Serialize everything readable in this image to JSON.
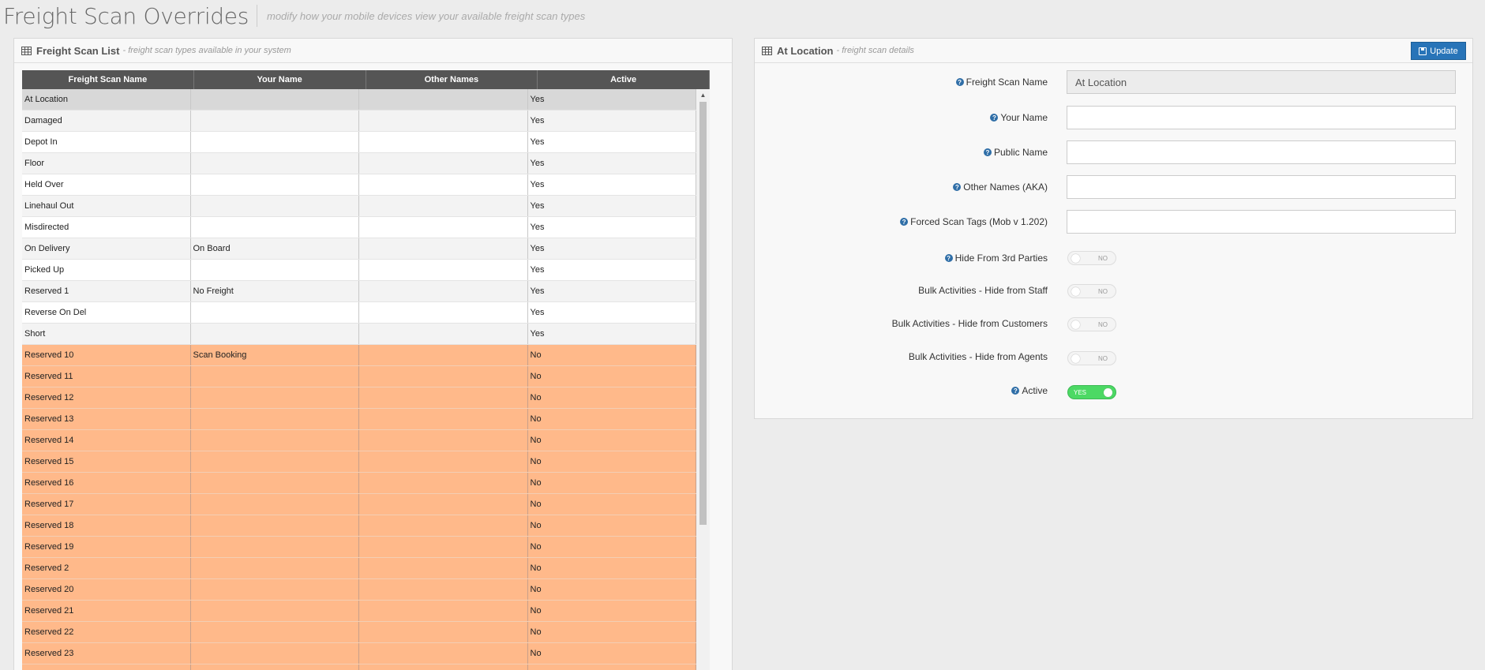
{
  "header": {
    "title": "Freight Scan Overrides",
    "subtitle": "modify how your mobile devices view your available freight scan types"
  },
  "list_panel": {
    "title": "Freight Scan List",
    "subtitle": "- freight scan types available in your system",
    "columns": [
      "Freight Scan Name",
      "Your Name",
      "Other Names",
      "Active"
    ],
    "rows": [
      {
        "name": "At Location",
        "your_name": "",
        "other_names": "",
        "active": "Yes",
        "state": "selected"
      },
      {
        "name": "Damaged",
        "your_name": "",
        "other_names": "",
        "active": "Yes",
        "state": "odd"
      },
      {
        "name": "Depot In",
        "your_name": "",
        "other_names": "",
        "active": "Yes",
        "state": "even"
      },
      {
        "name": "Floor",
        "your_name": "",
        "other_names": "",
        "active": "Yes",
        "state": "odd"
      },
      {
        "name": "Held Over",
        "your_name": "",
        "other_names": "",
        "active": "Yes",
        "state": "even"
      },
      {
        "name": "Linehaul Out",
        "your_name": "",
        "other_names": "",
        "active": "Yes",
        "state": "odd"
      },
      {
        "name": "Misdirected",
        "your_name": "",
        "other_names": "",
        "active": "Yes",
        "state": "even"
      },
      {
        "name": "On Delivery",
        "your_name": "On Board",
        "other_names": "",
        "active": "Yes",
        "state": "odd"
      },
      {
        "name": "Picked Up",
        "your_name": "",
        "other_names": "",
        "active": "Yes",
        "state": "even"
      },
      {
        "name": "Reserved 1",
        "your_name": "No Freight",
        "other_names": "",
        "active": "Yes",
        "state": "odd"
      },
      {
        "name": "Reverse On Del",
        "your_name": "",
        "other_names": "",
        "active": "Yes",
        "state": "even"
      },
      {
        "name": "Short",
        "your_name": "",
        "other_names": "",
        "active": "Yes",
        "state": "odd"
      },
      {
        "name": "Reserved 10",
        "your_name": "Scan Booking",
        "other_names": "",
        "active": "No",
        "state": "inactive"
      },
      {
        "name": "Reserved 11",
        "your_name": "",
        "other_names": "",
        "active": "No",
        "state": "inactive"
      },
      {
        "name": "Reserved 12",
        "your_name": "",
        "other_names": "",
        "active": "No",
        "state": "inactive"
      },
      {
        "name": "Reserved 13",
        "your_name": "",
        "other_names": "",
        "active": "No",
        "state": "inactive"
      },
      {
        "name": "Reserved 14",
        "your_name": "",
        "other_names": "",
        "active": "No",
        "state": "inactive"
      },
      {
        "name": "Reserved 15",
        "your_name": "",
        "other_names": "",
        "active": "No",
        "state": "inactive"
      },
      {
        "name": "Reserved 16",
        "your_name": "",
        "other_names": "",
        "active": "No",
        "state": "inactive"
      },
      {
        "name": "Reserved 17",
        "your_name": "",
        "other_names": "",
        "active": "No",
        "state": "inactive"
      },
      {
        "name": "Reserved 18",
        "your_name": "",
        "other_names": "",
        "active": "No",
        "state": "inactive"
      },
      {
        "name": "Reserved 19",
        "your_name": "",
        "other_names": "",
        "active": "No",
        "state": "inactive"
      },
      {
        "name": "Reserved 2",
        "your_name": "",
        "other_names": "",
        "active": "No",
        "state": "inactive"
      },
      {
        "name": "Reserved 20",
        "your_name": "",
        "other_names": "",
        "active": "No",
        "state": "inactive"
      },
      {
        "name": "Reserved 21",
        "your_name": "",
        "other_names": "",
        "active": "No",
        "state": "inactive"
      },
      {
        "name": "Reserved 22",
        "your_name": "",
        "other_names": "",
        "active": "No",
        "state": "inactive"
      },
      {
        "name": "Reserved 23",
        "your_name": "",
        "other_names": "",
        "active": "No",
        "state": "inactive"
      },
      {
        "name": "",
        "your_name": "",
        "other_names": "",
        "active": "",
        "state": "inactive"
      }
    ]
  },
  "detail_panel": {
    "title": "At Location",
    "subtitle": "- freight scan details",
    "update_label": "Update",
    "fields": {
      "freight_scan_name": {
        "label": "Freight Scan Name",
        "value": "At Location"
      },
      "your_name": {
        "label": "Your Name",
        "value": ""
      },
      "public_name": {
        "label": "Public Name",
        "value": ""
      },
      "other_names": {
        "label": "Other Names (AKA)",
        "value": ""
      },
      "forced_scan_tags": {
        "label": "Forced Scan Tags (Mob v 1.202)",
        "value": ""
      }
    },
    "toggles": {
      "hide_3rd": {
        "label": "Hide From 3rd Parties",
        "value": "NO"
      },
      "bulk_staff": {
        "label": "Bulk Activities - Hide from Staff",
        "value": "NO"
      },
      "bulk_customers": {
        "label": "Bulk Activities - Hide from Customers",
        "value": "NO"
      },
      "bulk_agents": {
        "label": "Bulk Activities - Hide from Agents",
        "value": "NO"
      },
      "active": {
        "label": "Active",
        "value": "YES"
      }
    }
  },
  "colors": {
    "accent": "#2874b8",
    "inactive_row": "#ffb98a",
    "toggle_on": "#4cd964",
    "table_header": "#555555"
  }
}
